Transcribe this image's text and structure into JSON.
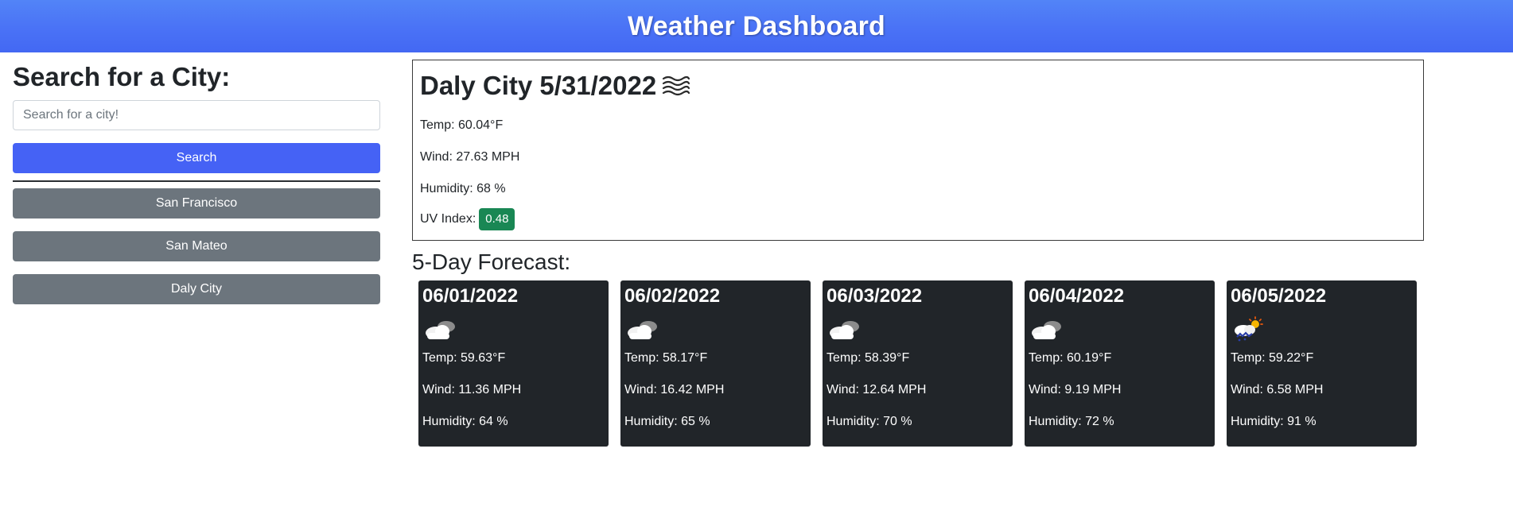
{
  "header": {
    "title": "Weather Dashboard"
  },
  "search": {
    "heading": "Search for a City:",
    "placeholder": "Search for a city!",
    "value": "",
    "button_label": "Search"
  },
  "history": [
    {
      "label": "San Francisco"
    },
    {
      "label": "San Mateo"
    },
    {
      "label": "Daly City"
    }
  ],
  "current": {
    "title": "Daly City 5/31/2022",
    "icon": "mist-icon",
    "temp": "Temp: 60.04°F",
    "wind": "Wind: 27.63 MPH",
    "humidity": "Humidity: 68 %",
    "uv_label": "UV Index:",
    "uv_value": "0.48",
    "uv_color": "#198754"
  },
  "forecast": {
    "heading": "5-Day Forecast:",
    "days": [
      {
        "date": "06/01/2022",
        "icon": "broken-clouds-icon",
        "temp": "Temp: 59.63°F",
        "wind": "Wind: 11.36 MPH",
        "humidity": "Humidity: 64 %"
      },
      {
        "date": "06/02/2022",
        "icon": "broken-clouds-icon",
        "temp": "Temp: 58.17°F",
        "wind": "Wind: 16.42 MPH",
        "humidity": "Humidity: 65 %"
      },
      {
        "date": "06/03/2022",
        "icon": "broken-clouds-icon",
        "temp": "Temp: 58.39°F",
        "wind": "Wind: 12.64 MPH",
        "humidity": "Humidity: 70 %"
      },
      {
        "date": "06/04/2022",
        "icon": "broken-clouds-icon",
        "temp": "Temp: 60.19°F",
        "wind": "Wind: 9.19 MPH",
        "humidity": "Humidity: 72 %"
      },
      {
        "date": "06/05/2022",
        "icon": "rain-sun-icon",
        "temp": "Temp: 59.22°F",
        "wind": "Wind: 6.58 MPH",
        "humidity": "Humidity: 91 %"
      }
    ]
  },
  "colors": {
    "header_blue": "#4a72f6",
    "search_button": "#4562f5",
    "history_button": "#6c757d",
    "card_bg": "#212529",
    "uv_green": "#198754"
  }
}
